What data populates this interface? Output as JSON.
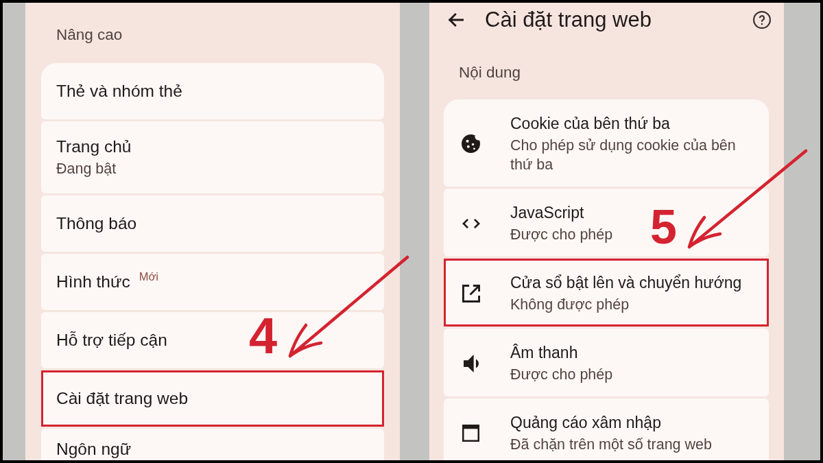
{
  "left_screen": {
    "section_title": "Nâng cao",
    "items": [
      {
        "title": "Thẻ và nhóm thẻ",
        "highlighted": false
      },
      {
        "title": "Trang chủ",
        "subtitle": "Đang bật",
        "highlighted": false
      },
      {
        "title": "Thông báo",
        "highlighted": false
      },
      {
        "title": "Hình thức",
        "badge": "Mới",
        "highlighted": false
      },
      {
        "title": "Hỗ trợ tiếp cận",
        "highlighted": false
      },
      {
        "title": "Cài đặt trang web",
        "highlighted": true
      },
      {
        "title": "Ngôn ngữ",
        "highlighted": false
      }
    ],
    "step_label": "4"
  },
  "right_screen": {
    "app_bar": {
      "title": "Cài đặt trang web"
    },
    "section_title": "Nội dung",
    "items": [
      {
        "kind": "cookies",
        "title": "Cookie của bên thứ ba",
        "subtitle": "Cho phép sử dụng cookie của bên thứ ba",
        "highlighted": false
      },
      {
        "kind": "javascript",
        "title": "JavaScript",
        "subtitle": "Được cho phép",
        "highlighted": false
      },
      {
        "kind": "popups",
        "title": "Cửa sổ bật lên và chuyển hướng",
        "subtitle": "Không được phép",
        "highlighted": true
      },
      {
        "kind": "sound",
        "title": "Âm thanh",
        "subtitle": "Được cho phép",
        "highlighted": false
      },
      {
        "kind": "ads",
        "title": "Quảng cáo xâm nhập",
        "subtitle": "Đã chặn trên một số trang web",
        "highlighted": false
      }
    ],
    "step_label": "5"
  }
}
